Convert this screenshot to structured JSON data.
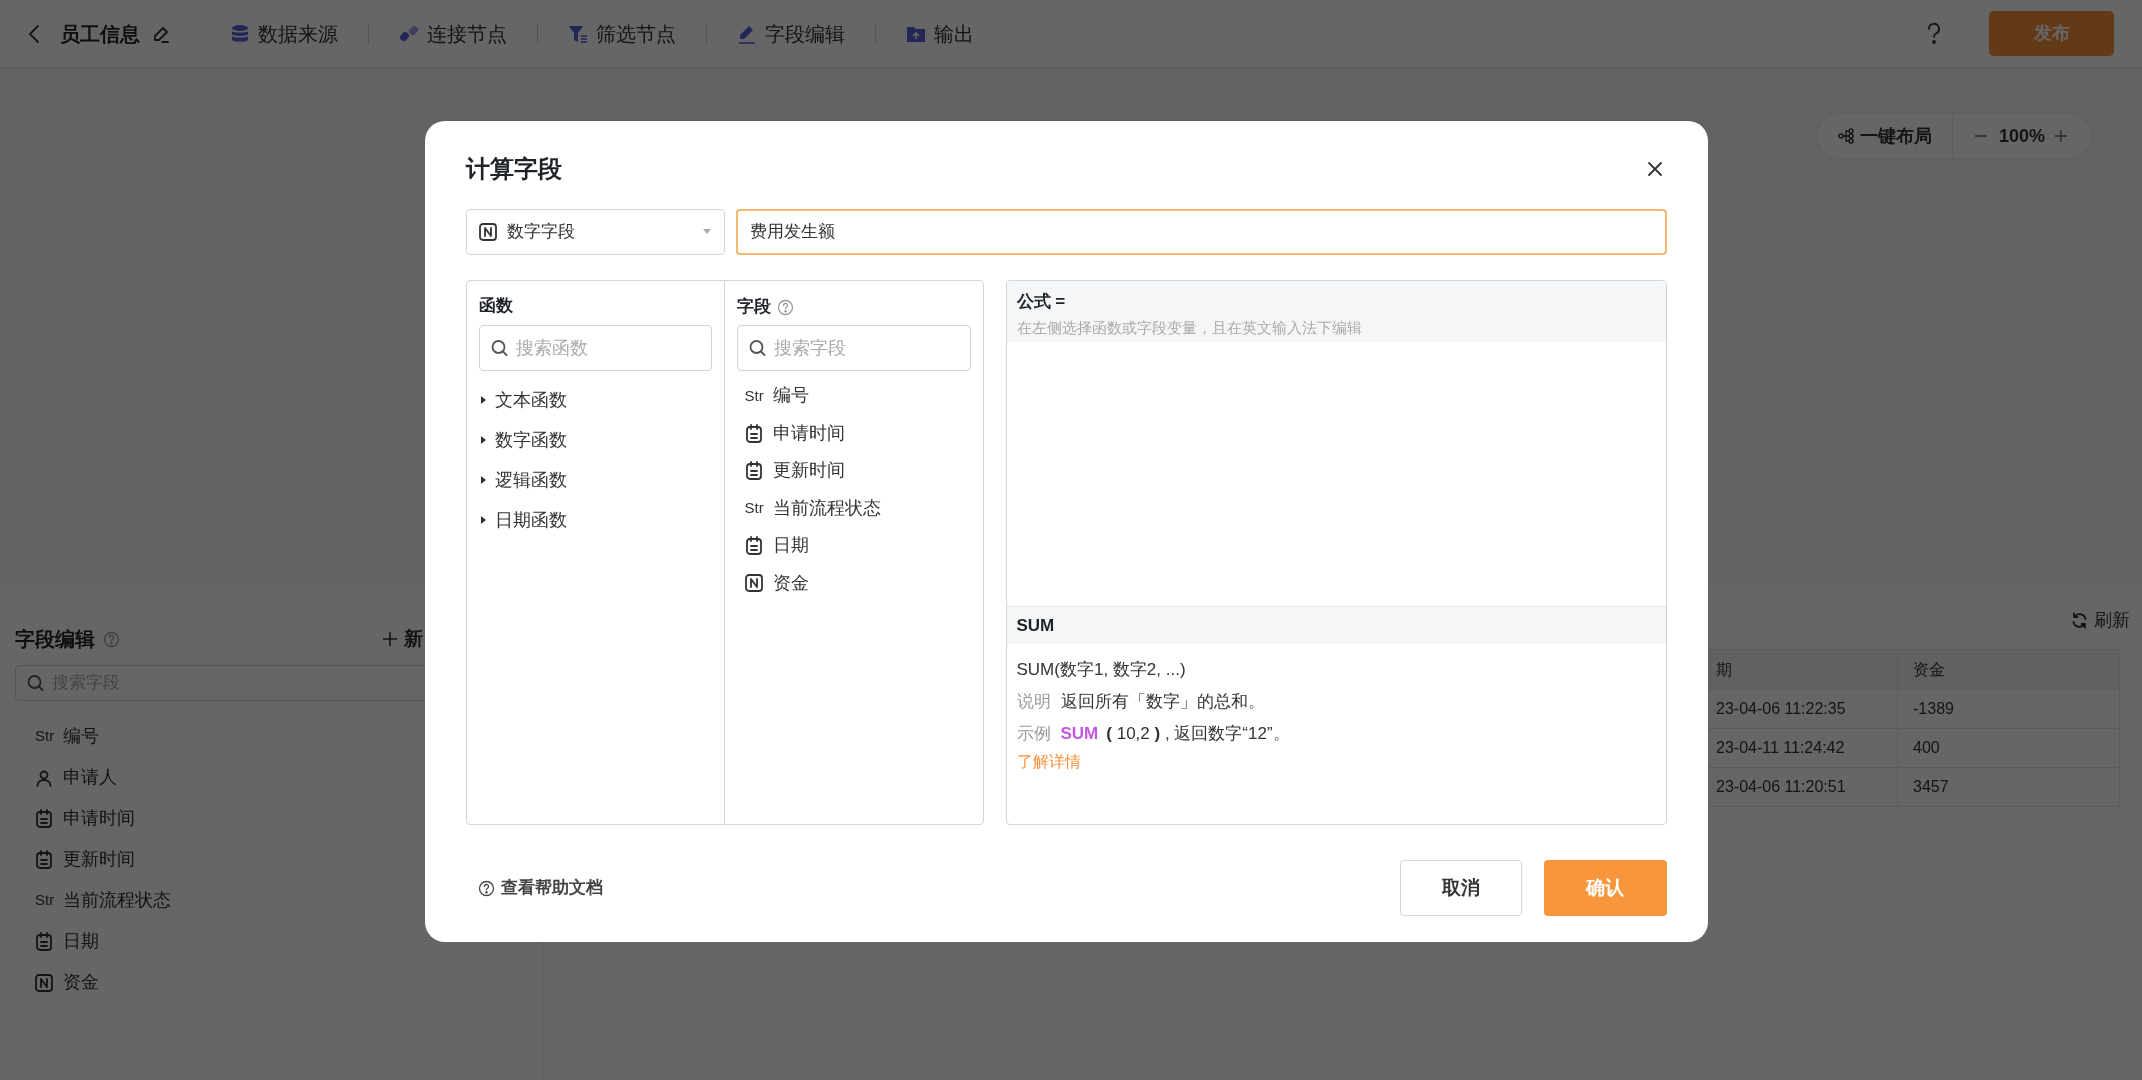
{
  "topbar": {
    "title": "员工信息",
    "tools": [
      {
        "kind": "database",
        "label": "数据来源"
      },
      {
        "kind": "link",
        "label": "连接节点"
      },
      {
        "kind": "filter",
        "label": "筛选节点"
      },
      {
        "kind": "edit",
        "label": "字段编辑"
      },
      {
        "kind": "output",
        "label": "输出"
      }
    ],
    "publish": "发布"
  },
  "canvas": {
    "layout_button": "一键布局",
    "zoom": "100%"
  },
  "field_panel": {
    "title": "字段编辑",
    "new_button": "新",
    "search_placeholder": "搜索字段",
    "fields": [
      {
        "kind": "str",
        "badge": "Str",
        "label": "编号"
      },
      {
        "kind": "person",
        "label": "申请人"
      },
      {
        "kind": "date",
        "label": "申请时间"
      },
      {
        "kind": "date",
        "label": "更新时间"
      },
      {
        "kind": "str",
        "badge": "Str",
        "label": "当前流程状态"
      },
      {
        "kind": "date",
        "label": "日期"
      },
      {
        "kind": "number",
        "label": "资金"
      }
    ]
  },
  "preview": {
    "refresh": "刷新",
    "columns": [
      "期",
      "资金"
    ],
    "rows": [
      [
        "23-04-06 11:22:35",
        "-1389"
      ],
      [
        "23-04-11 11:24:42",
        "400"
      ],
      [
        "23-04-06 11:20:51",
        "3457"
      ]
    ]
  },
  "dialog": {
    "title": "计算字段",
    "type_select": {
      "kind": "number",
      "value": "数字字段"
    },
    "name_input": {
      "value": "费用发生额",
      "focused": true
    },
    "functions": {
      "title": "函数",
      "search_placeholder": "搜索函数",
      "groups": [
        {
          "label": "文本函数",
          "expanded": false
        },
        {
          "label": "数字函数",
          "expanded": false
        },
        {
          "label": "逻辑函数",
          "expanded": false
        },
        {
          "label": "日期函数",
          "expanded": false
        }
      ]
    },
    "fields": {
      "title": "字段",
      "search_placeholder": "搜索字段",
      "items": [
        {
          "kind": "str",
          "badge": "Str",
          "label": "编号"
        },
        {
          "kind": "date",
          "label": "申请时间"
        },
        {
          "kind": "date",
          "label": "更新时间"
        },
        {
          "kind": "str",
          "badge": "Str",
          "label": "当前流程状态"
        },
        {
          "kind": "date",
          "label": "日期"
        },
        {
          "kind": "number",
          "label": "资金"
        }
      ]
    },
    "formula": {
      "label": "公式 =",
      "hint": "在左侧选择函数或字段变量，且在英文输入法下编辑"
    },
    "help": {
      "name": "SUM",
      "signature": "SUM(数字1, 数字2, ...)",
      "desc_label": "说明",
      "description": "返回所有「数字」的总和。",
      "example_label": "示例",
      "example_fn": "SUM",
      "example_rest": "**(** 10,2 **)** , 返回数字“12”。",
      "more_link": "了解详情"
    },
    "help_doc": "查看帮助文档",
    "cancel": "取消",
    "confirm": "确认"
  }
}
